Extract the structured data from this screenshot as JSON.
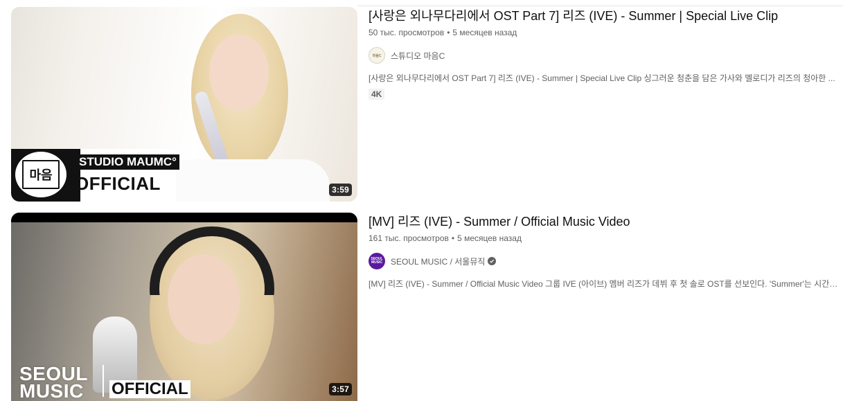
{
  "videos": [
    {
      "title": "[사랑은 외나무다리에서 OST Part 7] 리즈 (IVE) - Summer | Special Live Clip",
      "views": "50 тыс. просмотров",
      "age": "5 месяцев назад",
      "channel": "스튜디오 마음C",
      "verified": false,
      "description": "[사랑은 외나무다리에서 OST Part 7] 리즈 (IVE) - Summer | Special Live Clip 싱그러운 청춘을 담은 가사와 멜로디가 리즈의 청아한 ...",
      "badge": "4K",
      "duration": "3:59",
      "thumbnail": {
        "overlay_line1": "STUDIO MAUMC°",
        "overlay_line2": "OFFICIAL",
        "logo_text": "마음"
      }
    },
    {
      "title": "[MV] 리즈 (IVE) - Summer / Official Music Video",
      "views": "161 тыс. просмотров",
      "age": "5 месяцев назад",
      "channel": "SEOUL MUSIC / 서울뮤직",
      "verified": true,
      "description": "[MV] 리즈 (IVE) - Summer / Official Music Video 그룹 IVE (아이브) 멤버 리즈가 데뷔 후 첫 솔로 OST를 선보인다. 'Summer'는 시간이 ...",
      "duration": "3:57",
      "thumbnail": {
        "overlay_line1": "SEOUL",
        "overlay_line2": "MUSIC",
        "overlay_line3": "OFFICIAL",
        "avatar_text": "SEOUL MUSIC"
      }
    }
  ],
  "colors": {
    "title": "#0f0f0f",
    "meta": "#606060",
    "duration_bg": "#000000cc",
    "badge_bg": "#f2f2f2"
  }
}
